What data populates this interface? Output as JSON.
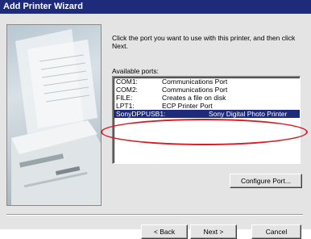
{
  "window": {
    "title": "Add Printer Wizard"
  },
  "instruction": "Click the port you want to use with this printer, and then click Next.",
  "ports_label": "Available ports:",
  "ports": [
    {
      "port": "COM1:",
      "description": "Communications Port"
    },
    {
      "port": "COM2:",
      "description": "Communications Port"
    },
    {
      "port": "FILE:",
      "description": "Creates a file on disk"
    },
    {
      "port": "LPT1:",
      "description": "ECP Printer Port"
    },
    {
      "port": "SonyDPPUSB1:",
      "description": "Sony Digital Photo Printer"
    }
  ],
  "selected_port_index": 4,
  "buttons": {
    "configure": "Configure Port...",
    "back": "< Back",
    "next": "Next >",
    "cancel": "Cancel"
  },
  "colors": {
    "titlebar": "#1e2a7a",
    "selection": "#1e2a7a",
    "highlight_oval": "#d81c24",
    "dialog_face": "#e4e4e4"
  }
}
